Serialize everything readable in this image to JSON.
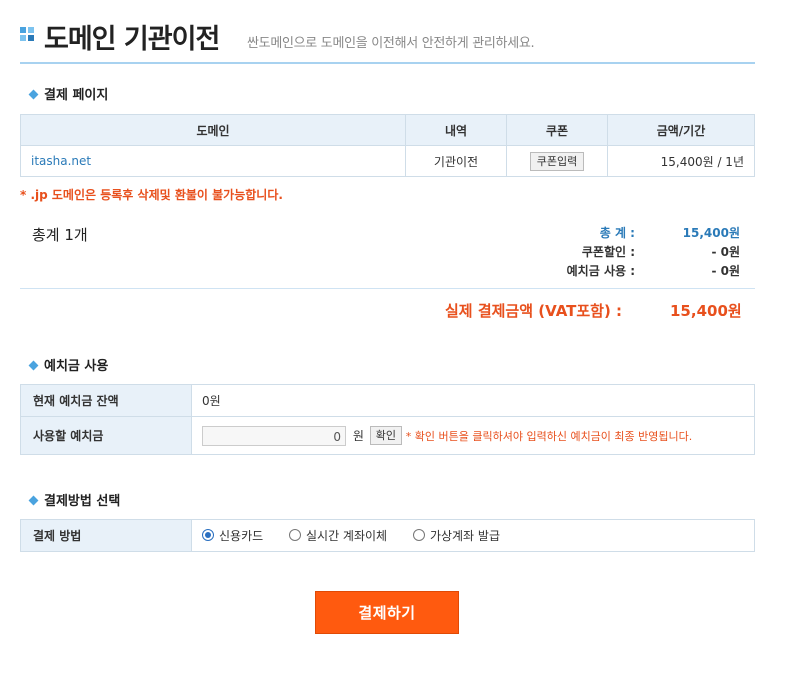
{
  "header": {
    "title": "도메인 기관이전",
    "subtitle": "싼도메인으로 도메인을 이전해서 안전하게 관리하세요."
  },
  "payment_section": {
    "title": "결제 페이지",
    "columns": [
      "도메인",
      "내역",
      "쿠폰",
      "금액/기간"
    ],
    "row": {
      "domain": "itasha.net",
      "item": "기관이전",
      "coupon_button": "쿠폰입력",
      "price": "15,400원 / 1년"
    },
    "notice": "* .jp 도메인은 등록후 삭제및 환불이 불가능합니다."
  },
  "summary": {
    "count_label": "총계 1개",
    "total_label": "총 계 :",
    "total_value": "15,400원",
    "coupon_label": "쿠폰할인 :",
    "coupon_value": "- 0원",
    "deposit_label": "예치금 사용 :",
    "deposit_value": "- 0원",
    "final_label": "실제 결제금액 (VAT포함) :",
    "final_value": "15,400원"
  },
  "deposit_section": {
    "title": "예치금 사용",
    "balance_label": "현재 예치금 잔액",
    "balance_value": "0원",
    "use_label": "사용할 예치금",
    "input_value": "0",
    "unit": "원",
    "confirm_button": "확인",
    "hint": "* 확인 버튼을 클릭하셔야 입력하신 예치금이 최종 반영됩니다."
  },
  "method_section": {
    "title": "결제방법 선택",
    "label": "결제 방법",
    "options": [
      "신용카드",
      "실시간 계좌이체",
      "가상계좌 발급"
    ],
    "selected": "신용카드"
  },
  "pay_button": "결제하기",
  "colors": {
    "accent_blue": "#4aa3df",
    "accent_orange": "#ff5a0f",
    "header_bg": "#e8f1f9",
    "total_blue": "#2a7ab8"
  }
}
